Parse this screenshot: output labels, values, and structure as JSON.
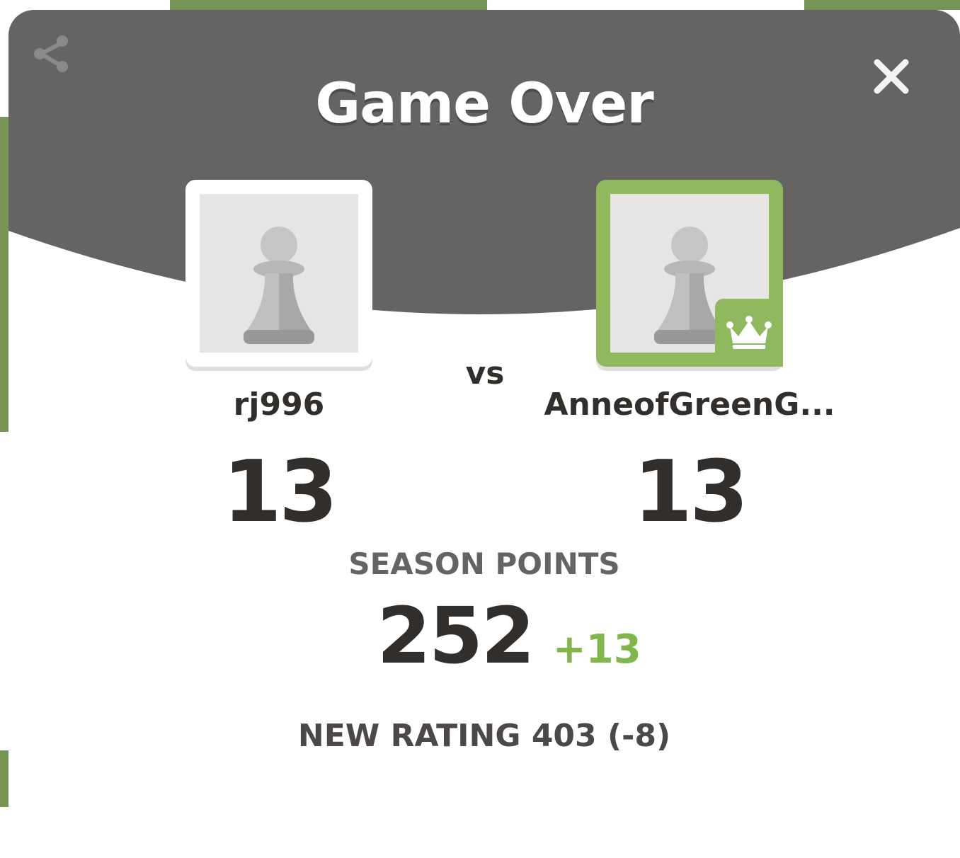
{
  "modal": {
    "title": "Game Over",
    "share_icon": "share-icon",
    "close_icon": "close-icon"
  },
  "players": {
    "left": {
      "username": "rj996",
      "score": "13",
      "avatar_icon": "pawn-icon"
    },
    "right": {
      "username": "AnneofGreenG...",
      "score": "13",
      "avatar_icon": "pawn-icon",
      "badge_icon": "crown-icon"
    }
  },
  "vs_label": "vs",
  "season": {
    "label": "SEASON POINTS",
    "value": "252",
    "delta": "+13"
  },
  "rating": {
    "text": "NEW RATING 403 (-8)"
  },
  "colors": {
    "header_gray": "#656463",
    "winner_green": "#8fb85f",
    "delta_green": "#81b64c",
    "text_dark": "#312e2b"
  }
}
